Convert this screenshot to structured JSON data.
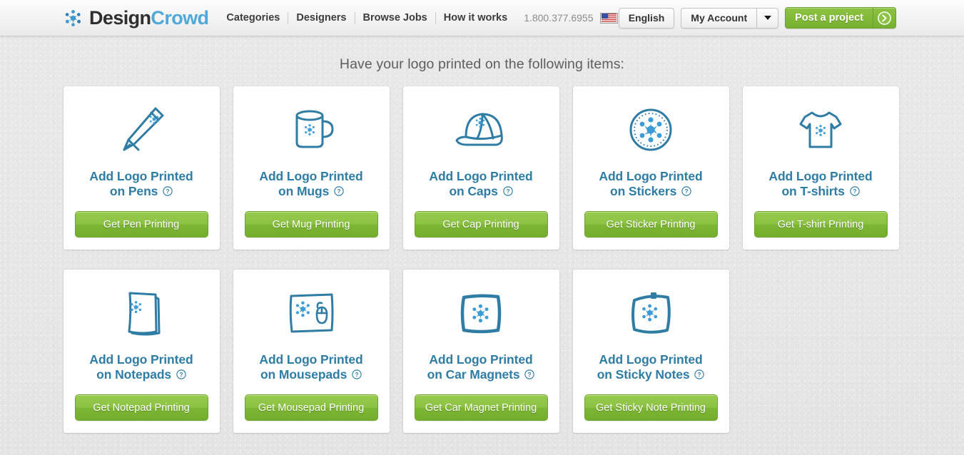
{
  "header": {
    "logo": {
      "mark": "designcrowd-starburst-icon",
      "part1": "Design",
      "part2": "Crowd"
    },
    "nav": [
      {
        "label": "Categories"
      },
      {
        "label": "Designers"
      },
      {
        "label": "Browse Jobs"
      },
      {
        "label": "How it works"
      }
    ],
    "phone": "1.800.377.6955",
    "flag": "us-flag-icon",
    "language_button": "English",
    "account_button": "My Account",
    "account_caret": "chevron-down-icon",
    "post_project_button": "Post a project",
    "post_project_arrow": "arrow-right-circle-icon",
    "colors": {
      "brand_blue": "#4fa8d8",
      "brand_dark": "#2f2f2f",
      "green": "#8dc342"
    }
  },
  "main": {
    "title": "Have your logo printed on the following items:",
    "help_icon": "question-circle-icon",
    "card_title_color": "#2f7ca4",
    "cards": [
      {
        "icon": "pen-icon",
        "title_line1": "Add Logo Printed",
        "title_line2": "on Pens",
        "button": "Get Pen Printing"
      },
      {
        "icon": "mug-icon",
        "title_line1": "Add Logo Printed",
        "title_line2": "on Mugs",
        "button": "Get Mug Printing"
      },
      {
        "icon": "cap-icon",
        "title_line1": "Add Logo Printed",
        "title_line2": "on Caps",
        "button": "Get Cap Printing"
      },
      {
        "icon": "sticker-icon",
        "title_line1": "Add Logo Printed",
        "title_line2": "on Stickers",
        "button": "Get Sticker Printing"
      },
      {
        "icon": "tshirt-icon",
        "title_line1": "Add Logo Printed",
        "title_line2": "on T-shirts",
        "button": "Get T-shirt Printing"
      },
      {
        "icon": "notepad-icon",
        "title_line1": "Add Logo Printed",
        "title_line2": "on Notepads",
        "button": "Get Notepad Printing"
      },
      {
        "icon": "mousepad-icon",
        "title_line1": "Add Logo Printed",
        "title_line2": "on Mousepads",
        "button": "Get Mousepad Printing"
      },
      {
        "icon": "car-magnet-icon",
        "title_line1": "Add Logo Printed",
        "title_line2": "on Car Magnets",
        "button": "Get Car Magnet Printing"
      },
      {
        "icon": "sticky-note-icon",
        "title_line1": "Add Logo Printed",
        "title_line2": "on Sticky Notes",
        "button": "Get Sticky Note Printing"
      }
    ]
  }
}
